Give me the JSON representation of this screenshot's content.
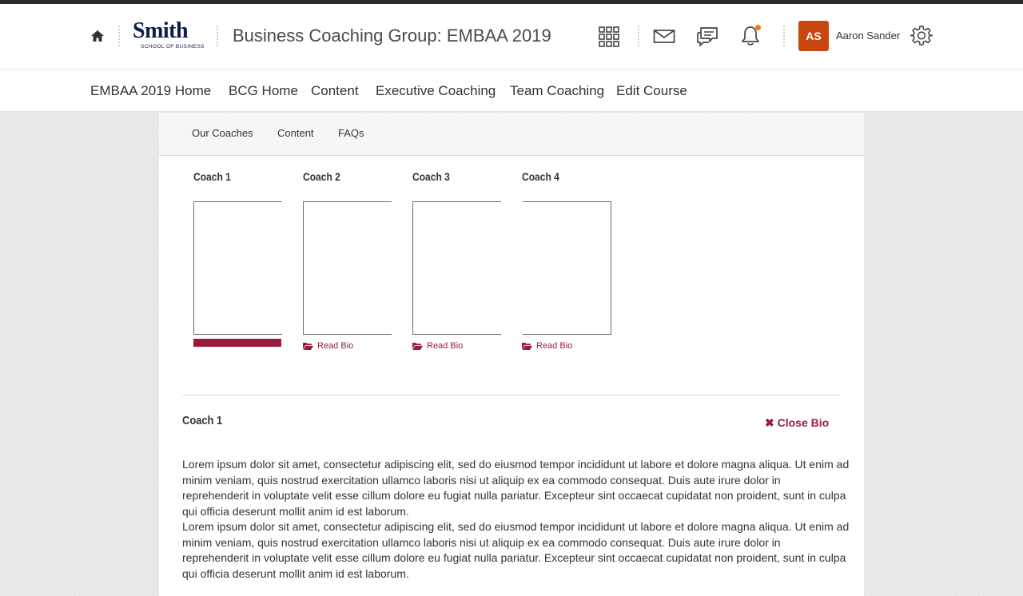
{
  "header": {
    "logo_word": "Smith",
    "logo_sub": "SCHOOL OF BUSINESS",
    "course_title": "Business Coaching Group: EMBAA 2019",
    "user_initials": "AS",
    "user_name": "Aaron Sander",
    "avatar_color": "#c9460f",
    "notification_dot_color": "#f07a1a",
    "icons": [
      "home-icon",
      "apps-grid-icon",
      "mail-icon",
      "chat-icon",
      "bell-icon",
      "gear-icon"
    ]
  },
  "nav": {
    "items": [
      {
        "label": "EMBAA 2019 Home"
      },
      {
        "label": "BCG Home"
      },
      {
        "label": "Content"
      },
      {
        "label": "Executive Coaching"
      },
      {
        "label": "Team Coaching"
      },
      {
        "label": "Edit Course"
      }
    ]
  },
  "subtabs": {
    "items": [
      {
        "label": "Our Coaches"
      },
      {
        "label": "Content"
      },
      {
        "label": "FAQs"
      }
    ]
  },
  "coaches": [
    {
      "name": "Coach 1",
      "read_bio": "",
      "active": true
    },
    {
      "name": "Coach 2",
      "read_bio": "Read Bio"
    },
    {
      "name": "Coach 3",
      "read_bio": "Read Bio"
    },
    {
      "name": "Coach 4",
      "read_bio": "Read Bio"
    }
  ],
  "bio": {
    "title": "Coach 1",
    "close_label": "✖ Close Bio",
    "paragraphs": [
      "Lorem ipsum dolor sit amet, consectetur adipiscing elit, sed do eiusmod tempor incididunt ut labore et dolore magna aliqua. Ut enim ad minim veniam, quis nostrud exercitation ullamco laboris nisi ut aliquip ex ea commodo consequat. Duis aute irure dolor in reprehenderit in voluptate velit esse cillum dolore eu fugiat nulla pariatur. Excepteur sint occaecat cupidatat non proident, sunt in culpa qui officia deserunt mollit anim id est laborum.",
      "Lorem ipsum dolor sit amet, consectetur adipiscing elit, sed do eiusmod tempor incididunt ut labore et dolore magna aliqua. Ut enim ad minim veniam, quis nostrud exercitation ullamco laboris nisi ut aliquip ex ea commodo consequat. Duis aute irure dolor in reprehenderit in voluptate velit esse cillum dolore eu fugiat nulla pariatur. Excepteur sint occaecat cupidatat non proident, sunt in culpa qui officia deserunt mollit anim id est laborum."
    ]
  },
  "colors": {
    "accent": "#9a1b3c",
    "brand_navy": "#0f1d4a"
  }
}
